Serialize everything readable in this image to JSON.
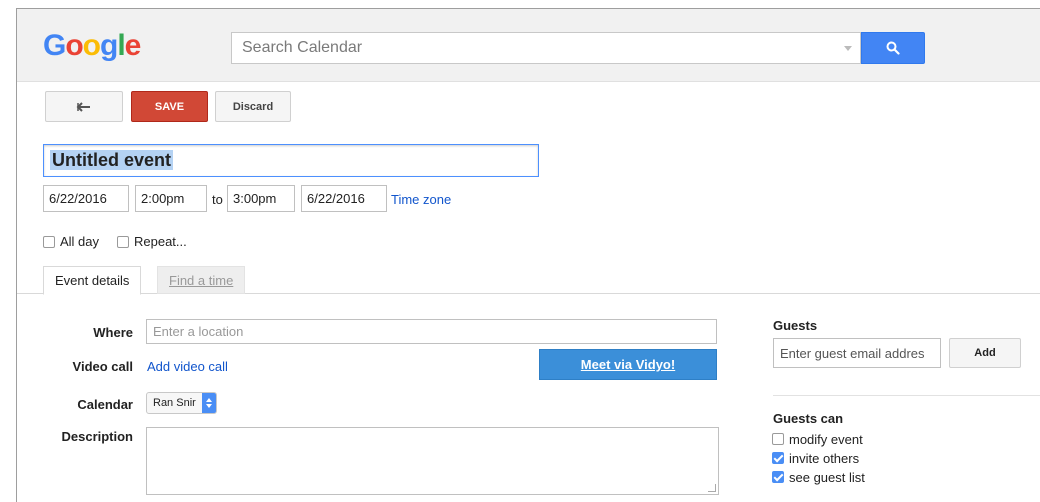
{
  "header": {
    "logo_letters": [
      "G",
      "o",
      "o",
      "g",
      "l",
      "e"
    ],
    "logo_colors": [
      "#4285f4",
      "#ea4335",
      "#fbbc05",
      "#4285f4",
      "#34a853",
      "#ea4335"
    ],
    "search_placeholder": "Search Calendar",
    "search_icon": "search-icon"
  },
  "toolbar": {
    "back_icon": "back-arrow-icon",
    "save_label": "SAVE",
    "discard_label": "Discard"
  },
  "event": {
    "title": "Untitled event",
    "start_date": "6/22/2016",
    "start_time": "2:00pm",
    "to_label": "to",
    "end_time": "3:00pm",
    "end_date": "6/22/2016",
    "timezone_label": "Time zone",
    "allday_label": "All day",
    "allday_checked": false,
    "repeat_label": "Repeat...",
    "repeat_checked": false
  },
  "tabs": {
    "details": "Event details",
    "find_time": "Find a time"
  },
  "details": {
    "where_label": "Where",
    "where_placeholder": "Enter a location",
    "video_label": "Video call",
    "video_link": "Add video call",
    "vidyo_button": "Meet via Vidyo!",
    "calendar_label": "Calendar",
    "calendar_value": "Ran Snir",
    "description_label": "Description"
  },
  "guests": {
    "title": "Guests",
    "input_placeholder": "Enter guest email addres",
    "add_label": "Add",
    "can_title": "Guests can",
    "options": [
      {
        "label": "modify event",
        "checked": false
      },
      {
        "label": "invite others",
        "checked": true
      },
      {
        "label": "see guest list",
        "checked": true
      }
    ]
  },
  "colors": {
    "accent_blue": "#4285f4",
    "save_red": "#d14836",
    "link_blue": "#1155cc",
    "vidyo_blue": "#3b8fd9"
  }
}
